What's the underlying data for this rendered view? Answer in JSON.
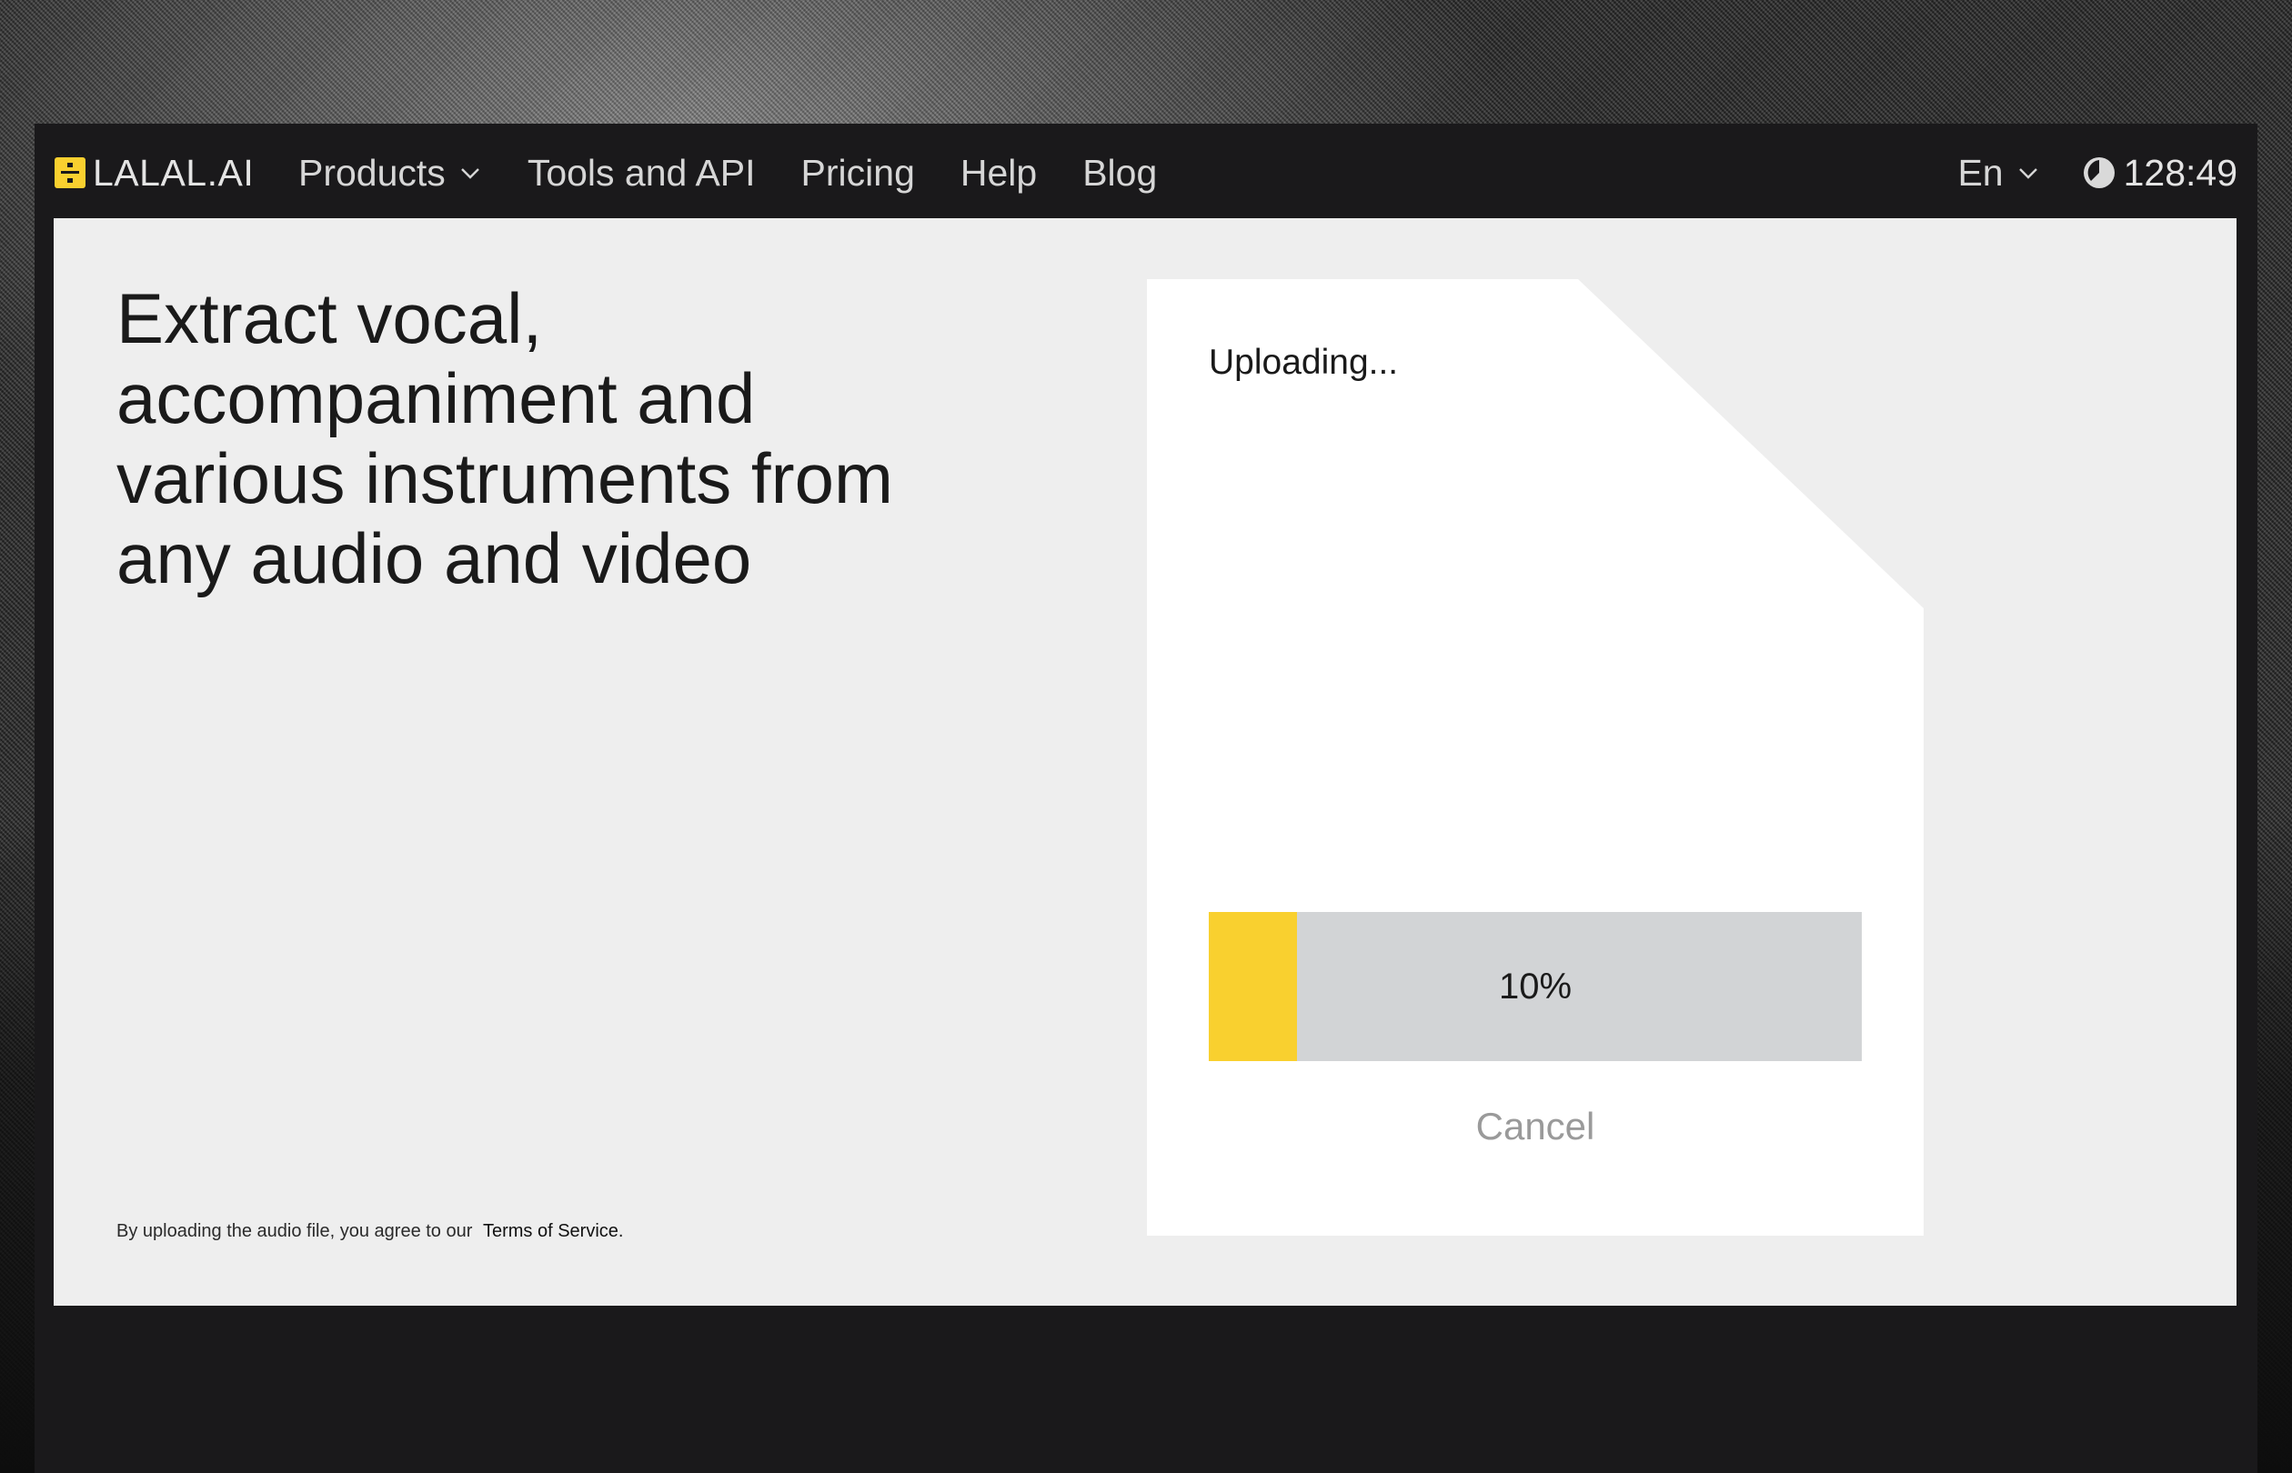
{
  "nav": {
    "logo_text": "LALAL.AI",
    "items": [
      {
        "label": "Products",
        "has_dropdown": true
      },
      {
        "label": "Tools and API",
        "has_dropdown": false
      },
      {
        "label": "Pricing",
        "has_dropdown": false
      },
      {
        "label": "Help",
        "has_dropdown": false
      },
      {
        "label": "Blog",
        "has_dropdown": false
      }
    ],
    "language": "En",
    "timer": "128:49"
  },
  "hero": {
    "headline": "Extract vocal, accompaniment and various instruments from any audio and video"
  },
  "terms": {
    "text": "By uploading the audio file, you agree to our",
    "link_label": "Terms of Service."
  },
  "upload": {
    "status": "Uploading...",
    "progress_percent": 10,
    "progress_label": "10%",
    "cancel_label": "Cancel"
  },
  "colors": {
    "accent": "#f9d02f",
    "nav_background": "#1a191b",
    "content_background": "#eeeeee",
    "progress_track": "#d2d4d6"
  },
  "icons": {
    "logo": "lalal-logo-icon",
    "dropdown": "chevron-down-icon",
    "timer": "clock-icon"
  }
}
